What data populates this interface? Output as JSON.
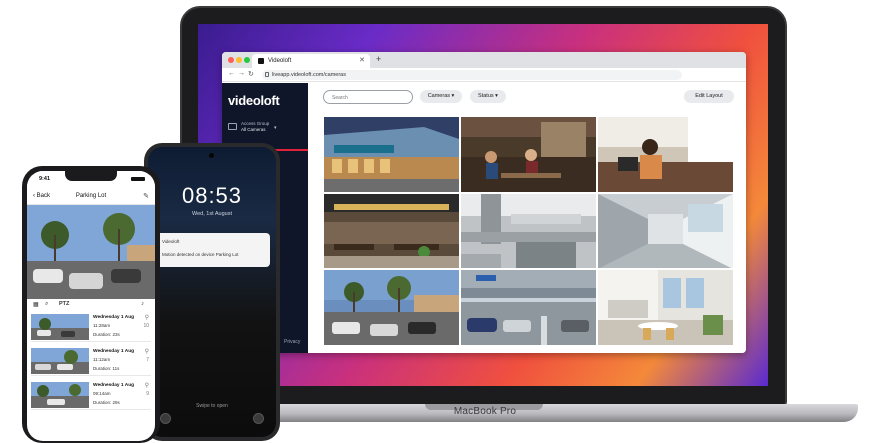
{
  "laptop": {
    "model_label": "MacBook Pro",
    "browser": {
      "tab_title": "Videoloft",
      "url": "liveapp.videoloft.com/cameras"
    },
    "app": {
      "logo": "videoloft",
      "account": {
        "line1": "Access Group",
        "line2": "All Cameras"
      },
      "sidebar_footer": "Privacy",
      "search_placeholder": "Search",
      "filters": [
        {
          "label": "Cameras"
        },
        {
          "label": "Status"
        }
      ],
      "edit_layout_label": "Edit Layout",
      "camera_tiles": [
        "storefront-cafe",
        "cafe-interior",
        "woman-at-laptop",
        "restaurant-seating",
        "industrial-kitchen",
        "corridor",
        "parking-lot-palms",
        "parking-garage",
        "break-room"
      ]
    }
  },
  "android": {
    "time": "08:53",
    "date": "Wed, 1st August",
    "notification": {
      "app": "Videoloft",
      "message": "Motion detected on device Parking Lot"
    },
    "swipe_hint": "Swipe to open"
  },
  "iphone": {
    "status_time": "9:41",
    "back_label": "Back",
    "title": "Parking Lot",
    "ptz_label": "PTZ",
    "events": [
      {
        "date": "Wednesday 1 Aug",
        "time": "11:28am",
        "duration": "Duration: 23s",
        "count": "10"
      },
      {
        "date": "Wednesday 1 Aug",
        "time": "11:12am",
        "duration": "Duration: 11s",
        "count": "7"
      },
      {
        "date": "Wednesday 1 Aug",
        "time": "09:14am",
        "duration": "Duration: 29s",
        "count": "9"
      }
    ]
  },
  "colors": {
    "brand_red": "#e4213a",
    "sidebar_navy": "#0f1629",
    "desktop_gradient": [
      "#3a1c8f",
      "#c9307d",
      "#f0503e",
      "#f4893a"
    ]
  }
}
